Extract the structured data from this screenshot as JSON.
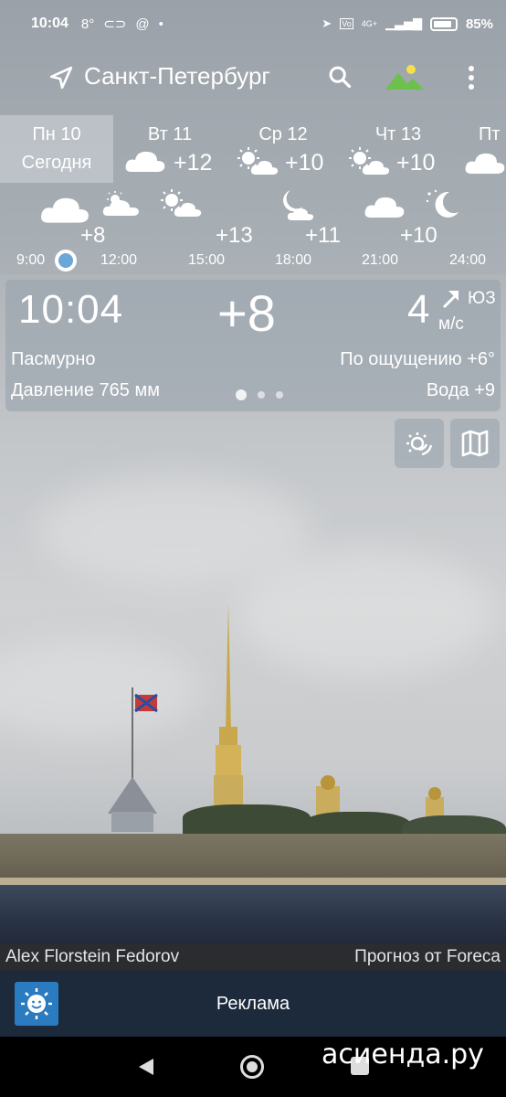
{
  "status_bar": {
    "time": "10:04",
    "temp": "8°",
    "network": "4G+",
    "battery_pct": "85%",
    "battery_level": 0.85
  },
  "app_bar": {
    "city": "Санкт-Петербург",
    "icons": [
      "location-arrow-icon",
      "search-icon",
      "landscape-photo-icon",
      "more-vert-icon"
    ]
  },
  "days": [
    {
      "name": "Пн 10",
      "sub": "Сегодня",
      "icon": "",
      "temp": ""
    },
    {
      "name": "Вт 11",
      "sub": "",
      "icon": "cloud-icon",
      "temp": "+12"
    },
    {
      "name": "Ср 12",
      "sub": "",
      "icon": "partly-sunny-icon",
      "temp": "+10"
    },
    {
      "name": "Чт 13",
      "sub": "",
      "icon": "partly-sunny-icon",
      "temp": "+10"
    },
    {
      "name": "Пт",
      "sub": "",
      "icon": "cloud-icon",
      "temp": ""
    }
  ],
  "hours": [
    {
      "label": "9:00",
      "temp": "+8",
      "icon": "cloud-icon"
    },
    {
      "label": "12:00",
      "temp": "",
      "icon": "cloud-sun-icon"
    },
    {
      "label": "15:00",
      "temp": "+13",
      "icon": "partly-sunny-icon"
    },
    {
      "label": "18:00",
      "temp": "+11",
      "icon": "moon-cloud-icon"
    },
    {
      "label": "21:00",
      "temp": "+10",
      "icon": "cloud-icon"
    },
    {
      "label": "24:00",
      "temp": "",
      "icon": "moon-star-icon"
    }
  ],
  "current": {
    "time": "10:04",
    "temp": "+8",
    "wind_speed": "4",
    "wind_dir": "ЮЗ",
    "wind_unit": "м/с",
    "condition": "Пасмурно",
    "feels_like": "По ощущению +6°",
    "pressure": "Давление 765 мм",
    "water": "Вода +9",
    "page_index": 0,
    "page_count": 3
  },
  "side_buttons": [
    "weather-radar-icon",
    "map-icon"
  ],
  "credits": {
    "photographer": "Alex Florstein Fedorov",
    "provider": "Прогноз от Foreca"
  },
  "ad": {
    "label": "Реклама",
    "icon": "sun-smile-icon"
  },
  "watermark": "асиенда.ру",
  "colors": {
    "ad_bg": "#1c2a3c",
    "ad_icon": "#2a7bc0",
    "dot_active": "#6aa6d6"
  }
}
